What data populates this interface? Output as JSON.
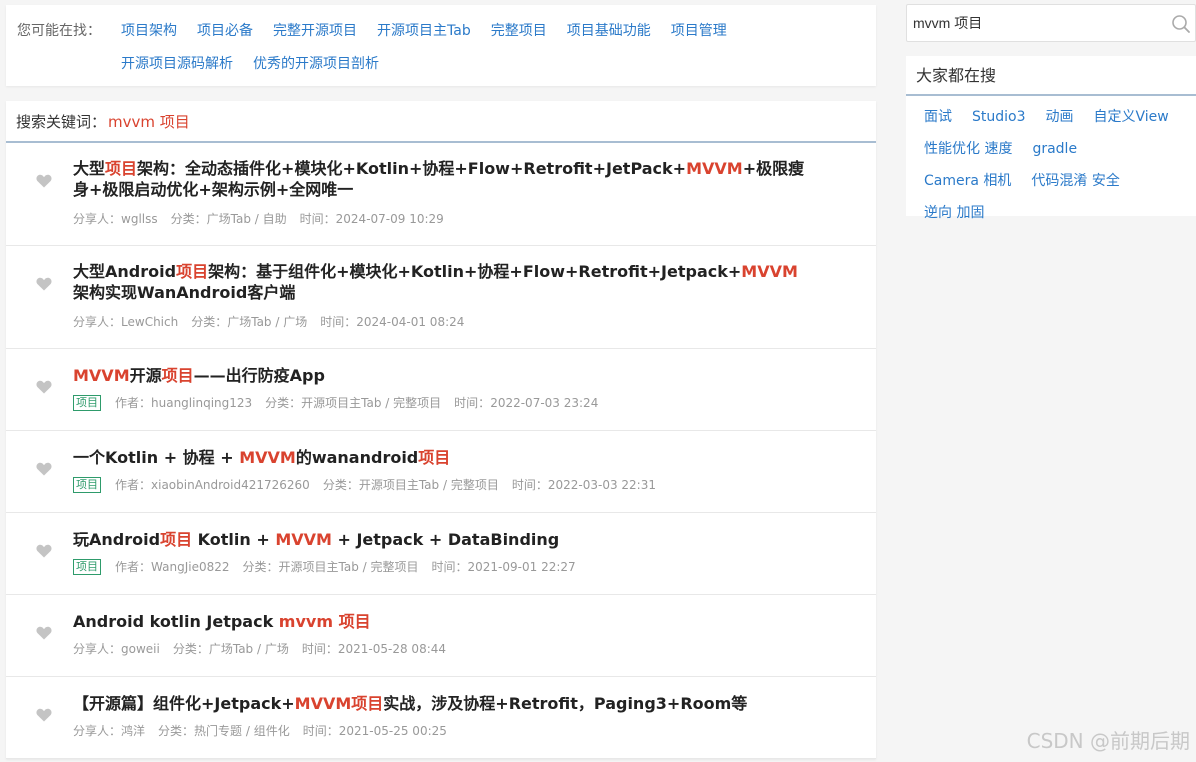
{
  "suggest": {
    "label": "您可能在找：",
    "links": [
      "项目架构",
      "项目必备",
      "完整开源项目",
      "开源项目主Tab",
      "完整项目",
      "项目基础功能",
      "项目管理",
      "开源项目源码解析",
      "优秀的开源项目剖析"
    ]
  },
  "keyword_bar": {
    "label": "搜索关键词：",
    "keyword": "mvvm 项目"
  },
  "results": [
    {
      "title_parts": [
        {
          "t": "大型",
          "hl": false
        },
        {
          "t": "项目",
          "hl": true
        },
        {
          "t": "架构：全动态插件化+模块化+Kotlin+协程+Flow+Retrofit+JetPack+",
          "hl": false
        },
        {
          "t": "MVVM",
          "hl": true
        },
        {
          "t": "+极限瘦身+极限启动优化+架构示例+全网唯一",
          "hl": false
        }
      ],
      "tag": "",
      "person_label": "分享人：",
      "person": "wgllss",
      "category_label": "分类：",
      "category": "广场Tab / 自助",
      "time_label": "时间：",
      "time": "2024-07-09 10:29"
    },
    {
      "title_parts": [
        {
          "t": "大型Android",
          "hl": false
        },
        {
          "t": "项目",
          "hl": true
        },
        {
          "t": "架构：基于组件化+模块化+Kotlin+协程+Flow+Retrofit+Jetpack+",
          "hl": false
        },
        {
          "t": "MVVM",
          "hl": true
        },
        {
          "t": "架构实现WanAndroid客户端",
          "hl": false
        }
      ],
      "tag": "",
      "person_label": "分享人：",
      "person": "LewChich",
      "category_label": "分类：",
      "category": "广场Tab / 广场",
      "time_label": "时间：",
      "time": "2024-04-01 08:24"
    },
    {
      "title_parts": [
        {
          "t": "MVVM",
          "hl": true
        },
        {
          "t": "开源",
          "hl": false
        },
        {
          "t": "项目",
          "hl": true
        },
        {
          "t": "——出行防疫App",
          "hl": false
        }
      ],
      "tag": "项目",
      "person_label": "作者：",
      "person": "huanglinqing123",
      "category_label": "分类：",
      "category": "开源项目主Tab / 完整项目",
      "time_label": "时间：",
      "time": "2022-07-03 23:24"
    },
    {
      "title_parts": [
        {
          "t": "一个Kotlin + 协程 + ",
          "hl": false
        },
        {
          "t": "MVVM",
          "hl": true
        },
        {
          "t": "的wanandroid",
          "hl": false
        },
        {
          "t": "项目",
          "hl": true
        }
      ],
      "tag": "项目",
      "person_label": "作者：",
      "person": "xiaobinAndroid421726260",
      "category_label": "分类：",
      "category": "开源项目主Tab / 完整项目",
      "time_label": "时间：",
      "time": "2022-03-03 22:31"
    },
    {
      "title_parts": [
        {
          "t": "玩Android",
          "hl": false
        },
        {
          "t": "项目",
          "hl": true
        },
        {
          "t": " Kotlin + ",
          "hl": false
        },
        {
          "t": "MVVM",
          "hl": true
        },
        {
          "t": " + Jetpack + DataBinding",
          "hl": false
        }
      ],
      "tag": "项目",
      "person_label": "作者：",
      "person": "WangJie0822",
      "category_label": "分类：",
      "category": "开源项目主Tab / 完整项目",
      "time_label": "时间：",
      "time": "2021-09-01 22:27"
    },
    {
      "title_parts": [
        {
          "t": "Android kotlin Jetpack ",
          "hl": false
        },
        {
          "t": "mvvm 项目",
          "hl": true
        }
      ],
      "tag": "",
      "person_label": "分享人：",
      "person": "goweii",
      "category_label": "分类：",
      "category": "广场Tab / 广场",
      "time_label": "时间：",
      "time": "2021-05-28 08:44"
    },
    {
      "title_parts": [
        {
          "t": "【开源篇】组件化+Jetpack+",
          "hl": false
        },
        {
          "t": "MVVM项目",
          "hl": true
        },
        {
          "t": "实战，涉及协程+Retrofit，Paging3+Room等",
          "hl": false
        }
      ],
      "tag": "",
      "person_label": "分享人：",
      "person": "鸿洋",
      "category_label": "分类：",
      "category": "热门专题 / 组件化",
      "time_label": "时间：",
      "time": "2021-05-25 00:25"
    }
  ],
  "search": {
    "value": "mvvm 项目"
  },
  "hot": {
    "title": "大家都在搜",
    "links": [
      "面试",
      "Studio3",
      "动画",
      "自定义View",
      "性能优化 速度",
      "gradle",
      "Camera 相机",
      "代码混淆 安全",
      "逆向 加固"
    ]
  },
  "watermark": "CSDN @前期后期",
  "colors": {
    "link": "#2b7ac9",
    "highlight": "#d9432f",
    "tag": "#2e9b6b",
    "heart": "#c4c4c4"
  }
}
